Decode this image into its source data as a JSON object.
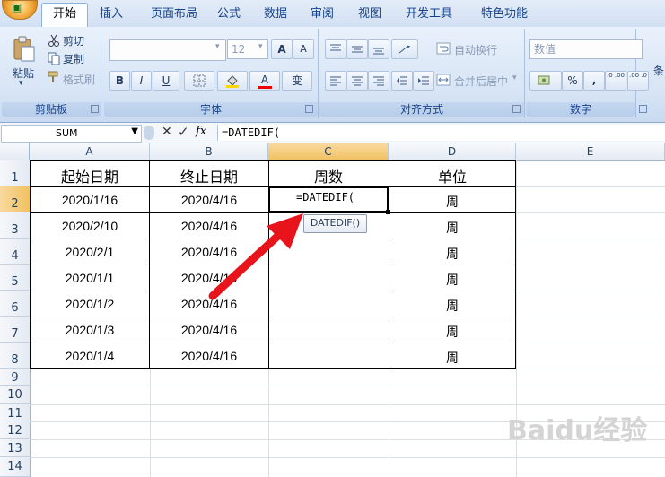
{
  "ribbon": {
    "tabs": [
      "开始",
      "插入",
      "页面布局",
      "公式",
      "数据",
      "审阅",
      "视图",
      "开发工具",
      "特色功能"
    ],
    "active_tab": "开始",
    "clipboard": {
      "paste_label": "粘贴",
      "cut_label": "剪切",
      "copy_label": "复制",
      "format_painter_label": "格式刷",
      "group_label": "剪贴板"
    },
    "font": {
      "font_name_value": "",
      "font_size_value": "12",
      "grow_label": "A",
      "shrink_label": "A",
      "bold_label": "B",
      "italic_label": "I",
      "underline_label": "U",
      "font_color_label": "A",
      "phonetic_label": "变",
      "group_label": "字体"
    },
    "alignment": {
      "wrap_text_label": "自动换行",
      "merge_center_label": "合并后居中",
      "group_label": "对齐方式"
    },
    "number": {
      "format_value": "数值",
      "percent_label": "%",
      "comma_label": ",",
      "increase_decimal_label": ".0 .00",
      "decrease_decimal_label": ".00 .0",
      "group_label": "数字"
    },
    "styles": {
      "conditional_label": "条"
    }
  },
  "formula_bar": {
    "name_box": "SUM",
    "cancel_icon": "✕",
    "enter_icon": "✓",
    "fx_label": "fx",
    "formula": "=DATEDIF("
  },
  "grid": {
    "columns": [
      "A",
      "B",
      "C",
      "D",
      "E"
    ],
    "selected_column": "C",
    "rows": [
      "1",
      "2",
      "3",
      "4",
      "5",
      "6",
      "7",
      "8",
      "9",
      "10",
      "11",
      "12",
      "13",
      "14"
    ],
    "header_row": [
      "起始日期",
      "终止日期",
      "周数",
      "单位"
    ],
    "data_rows": [
      [
        "2020/1/16",
        "2020/4/16",
        "=DATEDIF(",
        "周"
      ],
      [
        "2020/2/10",
        "2020/4/16",
        "",
        "周"
      ],
      [
        "2020/2/1",
        "2020/4/16",
        "",
        "周"
      ],
      [
        "2020/1/1",
        "2020/4/16",
        "",
        "周"
      ],
      [
        "2020/1/2",
        "2020/4/16",
        "",
        "周"
      ],
      [
        "2020/1/3",
        "2020/4/16",
        "",
        "周"
      ],
      [
        "2020/1/4",
        "2020/4/16",
        "",
        "周"
      ]
    ],
    "active_cell": "C2",
    "tooltip": "DATEDIF()"
  },
  "annotation": {
    "arrow_color": "#e8141b"
  },
  "watermark": {
    "text": "Baidu经验"
  },
  "colors": {
    "ribbon_blue": "#15428b",
    "selected_header": "#f1c15f"
  }
}
